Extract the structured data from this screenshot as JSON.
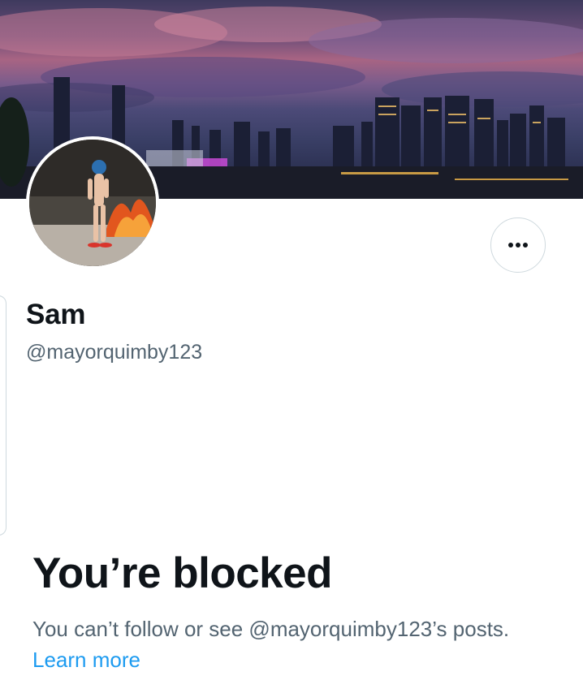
{
  "profile": {
    "display_name": "Sam",
    "handle": "@mayorquimby123",
    "banner_image": "melbourne-city-skyline-at-dusk",
    "avatar_image": "person-in-helmet-walking-past-fire"
  },
  "actions": {
    "more_icon": "more-horizontal-icon"
  },
  "blocked": {
    "title": "You’re blocked",
    "message": "You can’t follow or see @mayorquimby123’s posts.",
    "learn_more": "Learn more"
  },
  "colors": {
    "text_primary": "#0f1419",
    "text_secondary": "#536471",
    "link": "#1d9bf0",
    "border": "#cfd9de"
  }
}
